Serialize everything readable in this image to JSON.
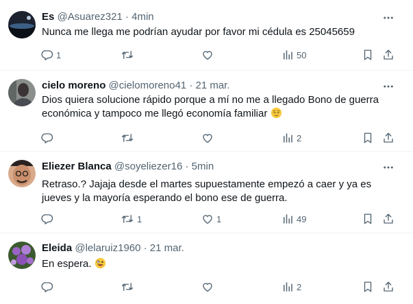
{
  "tweets": [
    {
      "display_name": "Es",
      "meta": "@Asuarez321 · 4min",
      "text": "Nunca me llega me podrían ayudar por favor mi cédula es 25045659",
      "avatar_icon": "dark-landscape-avatar",
      "stats": {
        "replies": "1",
        "retweets": "",
        "likes": "",
        "views": "50"
      }
    },
    {
      "display_name": "cielo moreno",
      "meta": "@cielomoreno41 · 21 mar.",
      "text": "Dios quiera solucione rápido porque a mí no me a llegado Bono de guerra económica y tampoco me llegó economía familiar",
      "emoji": "pensive-face-emoji",
      "avatar_icon": "person-photo-avatar",
      "stats": {
        "replies": "",
        "retweets": "",
        "likes": "",
        "views": "2"
      }
    },
    {
      "display_name": "Eliezer Blanca",
      "meta": "@soyeliezer16 · 5min",
      "text": "Retraso.? Jajaja desde el martes supuestamente empezó a caer y ya es jueves y la mayoría esperando el bono ese de guerra.",
      "avatar_icon": "man-with-glasses-avatar",
      "stats": {
        "replies": "",
        "retweets": "1",
        "likes": "1",
        "views": "49"
      }
    },
    {
      "display_name": "Eleida",
      "meta": "@lelaruiz1960 · 21 mar.",
      "text": "En espera.",
      "emoji": "zany-face-emoji",
      "avatar_icon": "purple-flowers-avatar",
      "stats": {
        "replies": "",
        "retweets": "",
        "likes": "",
        "views": "2"
      }
    }
  ],
  "colors": {
    "text": "#0f1419",
    "secondary": "#536471",
    "divider": "#eff3f4"
  },
  "icons": [
    "reply-icon",
    "retweet-icon",
    "like-icon",
    "views-icon",
    "bookmark-icon",
    "share-icon",
    "more-icon"
  ]
}
